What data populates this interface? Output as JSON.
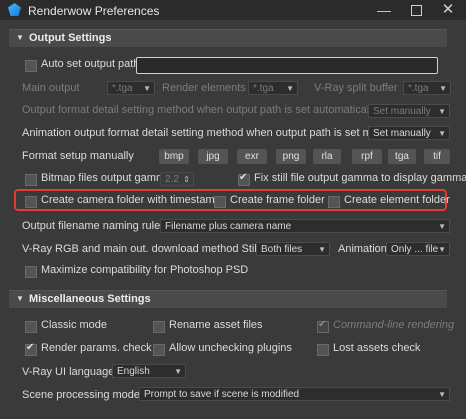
{
  "window": {
    "title": "Renderwow Preferences",
    "minimize": "—",
    "close": "✕"
  },
  "output": {
    "header": "Output Settings",
    "auto_set_output_path": {
      "label": "Auto set output path",
      "checked": false
    },
    "main_output": {
      "label": "Main output",
      "value": "*.tga"
    },
    "render_elements": {
      "label": "Render elements",
      "value": "*.tga"
    },
    "vray_split_buffer": {
      "label": "V-Ray split buffer",
      "value": "*.tga"
    },
    "format_detail_method": {
      "label": "Output format detail setting method when output path is set automatically",
      "value": "Set manually"
    },
    "anim_format_detail_method": {
      "label": "Animation output format detail setting method when output path is set manual",
      "value": "Set manually"
    },
    "format_setup": {
      "label": "Format setup manually",
      "buttons": [
        "bmp",
        "jpg",
        "exr",
        "png",
        "rla",
        "rpf",
        "tga",
        "tif"
      ]
    },
    "bitmap_gamma": {
      "label": "Bitmap files output gamma",
      "value": "2.2",
      "checked": false
    },
    "fix_still_gamma": {
      "label": "Fix still file output gamma to display gamma",
      "checked": true
    },
    "camera_folder_timestamp": {
      "label": "Create camera folder with timestamp",
      "checked": false
    },
    "frame_folder": {
      "label": "Create frame folder",
      "checked": false
    },
    "element_folder": {
      "label": "Create element folder",
      "checked": false
    },
    "filename_rule": {
      "label": "Output filename naming rule",
      "value": "Filename plus camera name"
    },
    "vray_download": {
      "label": "V-Ray RGB and main out. download method Still",
      "still_value": "Both files",
      "animation_label": "Animation",
      "animation_value": "Only ... file"
    },
    "photoshop_compat": {
      "label": "Maximize compatibility for Photoshop PSD",
      "checked": false
    }
  },
  "misc": {
    "header": "Miscellaneous Settings",
    "classic_mode": {
      "label": "Classic mode",
      "checked": false
    },
    "rename_asset": {
      "label": "Rename asset files",
      "checked": false
    },
    "cmdline_rendering": {
      "label": "Command-line rendering",
      "checked": true
    },
    "render_params_check": {
      "label": "Render params. check",
      "checked": true
    },
    "allow_unchecking": {
      "label": "Allow unchecking plugins",
      "checked": false
    },
    "lost_assets": {
      "label": "Lost assets check",
      "checked": false
    },
    "ui_language": {
      "label": "V-Ray UI language",
      "value": "English"
    },
    "scene_processing": {
      "label": "Scene processing modes",
      "value": "Prompt to save if scene is modified"
    }
  },
  "colors": {
    "highlight": "#e53b34",
    "background": "#3a3a3a",
    "header": "#4a4a4a"
  },
  "icons": {
    "app": "renderwow-app-icon",
    "collapse": "collapse-triangle-icon",
    "dropdown": "chevron-down-icon"
  }
}
